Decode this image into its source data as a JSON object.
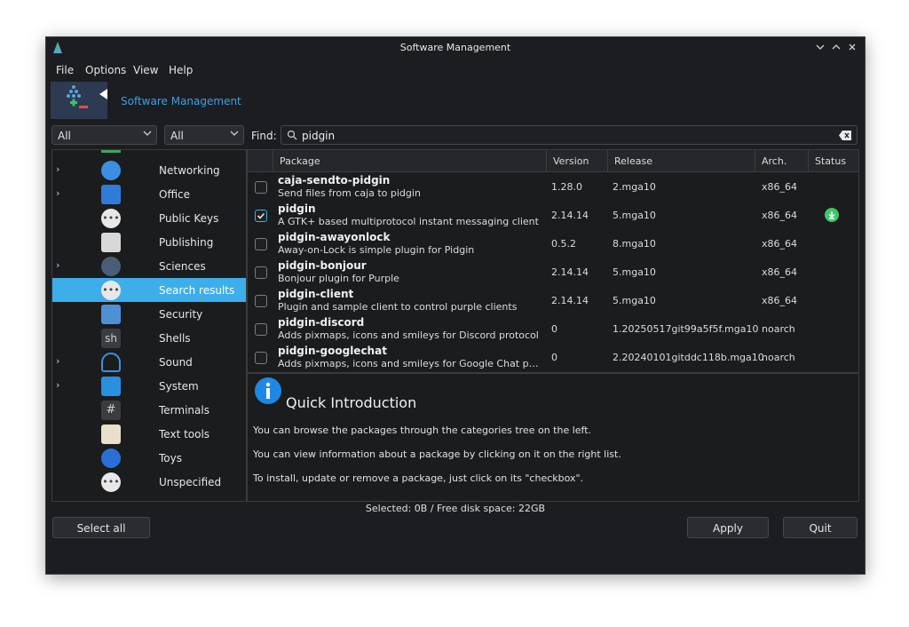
{
  "window": {
    "title": "Software Management"
  },
  "menu": [
    "File",
    "Options",
    "View",
    "Help"
  ],
  "banner": {
    "title": "Software Management"
  },
  "filters": {
    "group_filter": "All",
    "status_filter": "All"
  },
  "search": {
    "label": "Find:",
    "value": "pidgin"
  },
  "categories": [
    {
      "label": "Networking",
      "expandable": true,
      "icon": "globe-icon"
    },
    {
      "label": "Office",
      "expandable": true,
      "icon": "office-icon"
    },
    {
      "label": "Public Keys",
      "expandable": false,
      "icon": "more-icon"
    },
    {
      "label": "Publishing",
      "expandable": false,
      "icon": "printer-icon"
    },
    {
      "label": "Sciences",
      "expandable": true,
      "icon": "flask-icon"
    },
    {
      "label": "Search results",
      "expandable": false,
      "icon": "more-icon",
      "selected": true
    },
    {
      "label": "Security",
      "expandable": false,
      "icon": "lock-icon"
    },
    {
      "label": "Shells",
      "expandable": false,
      "icon": "shell-icon",
      "icon_text": "sh"
    },
    {
      "label": "Sound",
      "expandable": true,
      "icon": "headphones-icon"
    },
    {
      "label": "System",
      "expandable": true,
      "icon": "system-icon"
    },
    {
      "label": "Terminals",
      "expandable": false,
      "icon": "terminal-icon",
      "icon_text": "#"
    },
    {
      "label": "Text tools",
      "expandable": false,
      "icon": "pen-icon"
    },
    {
      "label": "Toys",
      "expandable": false,
      "icon": "toys-icon"
    },
    {
      "label": "Unspecified",
      "expandable": false,
      "icon": "more-icon"
    }
  ],
  "columns": [
    "Package",
    "Version",
    "Release",
    "Arch.",
    "Status"
  ],
  "packages": [
    {
      "name": "caja-sendto-pidgin",
      "desc": "Send files from caja to pidgin",
      "version": "1.28.0",
      "release": "2.mga10",
      "arch": "x86_64",
      "checked": false,
      "installed": false
    },
    {
      "name": "pidgin",
      "desc": "A GTK+ based multiprotocol instant messaging client",
      "version": "2.14.14",
      "release": "5.mga10",
      "arch": "x86_64",
      "checked": true,
      "installed": true
    },
    {
      "name": "pidgin-awayonlock",
      "desc": "Away-on-Lock is simple plugin for Pidgin",
      "version": "0.5.2",
      "release": "8.mga10",
      "arch": "x86_64",
      "checked": false,
      "installed": false
    },
    {
      "name": "pidgin-bonjour",
      "desc": "Bonjour plugin for Purple",
      "version": "2.14.14",
      "release": "5.mga10",
      "arch": "x86_64",
      "checked": false,
      "installed": false
    },
    {
      "name": "pidgin-client",
      "desc": "Plugin and sample client to control purple clients",
      "version": "2.14.14",
      "release": "5.mga10",
      "arch": "x86_64",
      "checked": false,
      "installed": false
    },
    {
      "name": "pidgin-discord",
      "desc": "Adds pixmaps, icons and smileys for Discord protocol",
      "version": "0",
      "release": "1.20250517git99a5f5f.mga10",
      "arch": "noarch",
      "checked": false,
      "installed": false
    },
    {
      "name": "pidgin-googlechat",
      "desc": "Adds pixmaps, icons and smileys for Google Chat prot…",
      "version": "0",
      "release": "2.20240101gitddc118b.mga10",
      "arch": "noarch",
      "checked": false,
      "installed": false
    }
  ],
  "info": {
    "heading": "Quick Introduction",
    "lines": [
      "You can browse the packages through the categories tree on the left.",
      "You can view information about a package by clicking on it on the right list.",
      "To install, update or remove a package, just click on its \"checkbox\"."
    ]
  },
  "status": "Selected: 0B / Free disk space: 22GB",
  "buttons": {
    "select_all": "Select all",
    "apply": "Apply",
    "quit": "Quit"
  },
  "colors": {
    "accent": "#3daee9",
    "banner_link": "#3d9fe6",
    "installed": "#3ec76a",
    "info_icon": "#1e88e5"
  }
}
